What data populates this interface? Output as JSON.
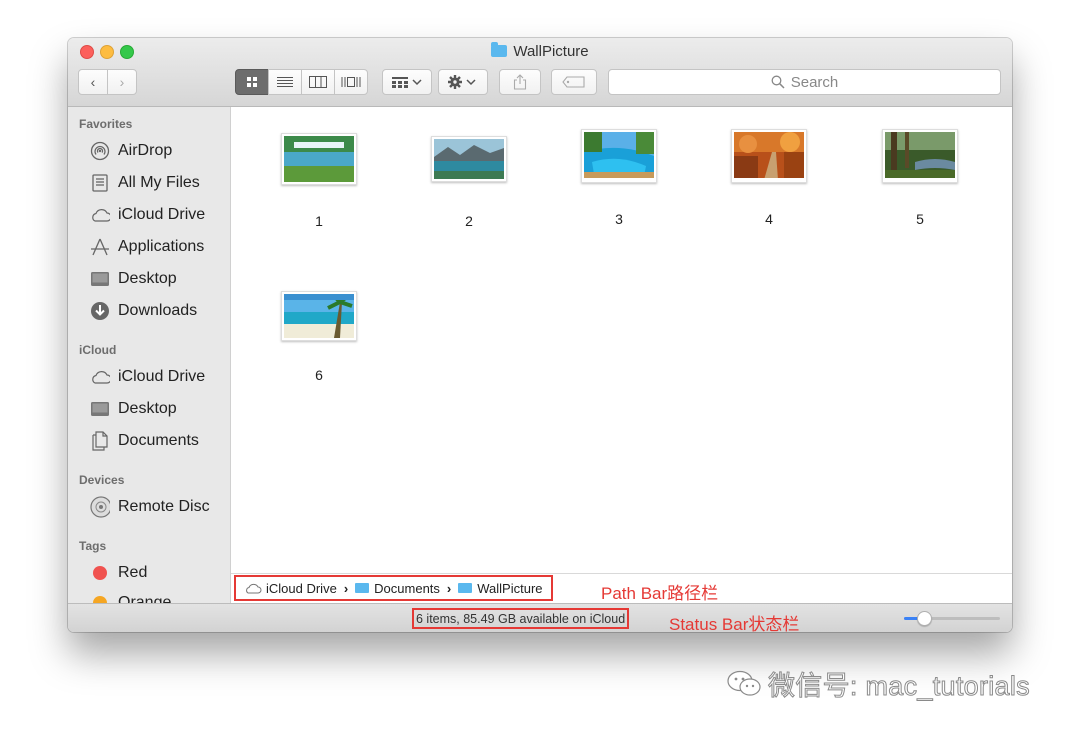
{
  "window": {
    "title": "WallPicture"
  },
  "toolbar": {
    "back_icon": "‹",
    "forward_icon": "›",
    "search_placeholder": "Search"
  },
  "sidebar": {
    "sections": [
      {
        "label": "Favorites",
        "items": [
          {
            "label": "AirDrop",
            "icon": "airdrop-icon"
          },
          {
            "label": "All My Files",
            "icon": "all-files-icon"
          },
          {
            "label": "iCloud Drive",
            "icon": "cloud-icon"
          },
          {
            "label": "Applications",
            "icon": "applications-icon"
          },
          {
            "label": "Desktop",
            "icon": "desktop-icon"
          },
          {
            "label": "Downloads",
            "icon": "downloads-icon"
          }
        ]
      },
      {
        "label": "iCloud",
        "items": [
          {
            "label": "iCloud Drive",
            "icon": "cloud-icon"
          },
          {
            "label": "Desktop",
            "icon": "desktop-icon"
          },
          {
            "label": "Documents",
            "icon": "documents-icon"
          }
        ]
      },
      {
        "label": "Devices",
        "items": [
          {
            "label": "Remote Disc",
            "icon": "disc-icon"
          }
        ]
      },
      {
        "label": "Tags",
        "items": [
          {
            "label": "Red",
            "color": "#f0524f"
          },
          {
            "label": "Orange",
            "color": "#f5a623"
          }
        ]
      }
    ]
  },
  "files": [
    {
      "name": "1"
    },
    {
      "name": "2"
    },
    {
      "name": "3"
    },
    {
      "name": "4"
    },
    {
      "name": "5"
    },
    {
      "name": "6"
    }
  ],
  "pathbar": {
    "segments": [
      "iCloud Drive",
      "Documents",
      "WallPicture"
    ]
  },
  "statusbar": {
    "text": "6 items, 85.49 GB available on iCloud",
    "icon_size_fraction": 0.2
  },
  "annotations": {
    "path": "Path  Bar路径栏",
    "status": "Status Bar状态栏"
  },
  "watermark": {
    "text": "微信号: mac_tutorials"
  },
  "colors": {
    "annotation": "#e53935",
    "accent": "#3b82f6",
    "folder": "#5ab8ee"
  }
}
